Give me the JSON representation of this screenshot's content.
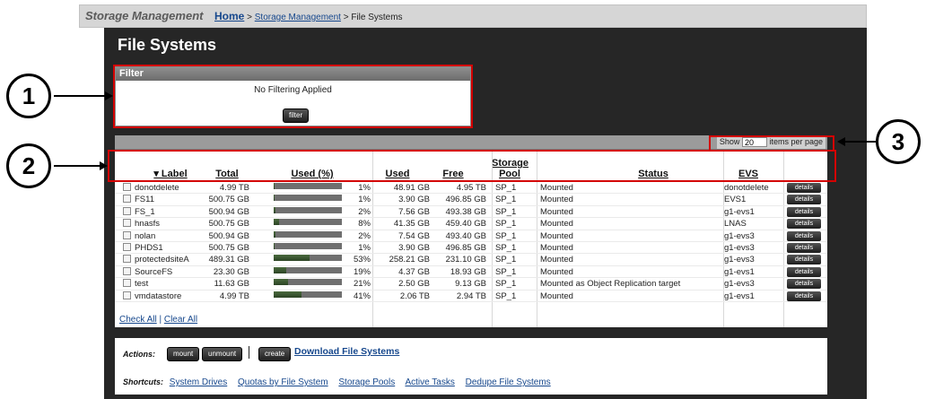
{
  "header": {
    "app_title": "Storage Management",
    "home": "Home",
    "sep1": " > ",
    "crumb_storage": "Storage Management",
    "sep2": " > ",
    "current": "File Systems"
  },
  "page_title": "File Systems",
  "filter": {
    "heading": "Filter",
    "note": "No Filtering Applied",
    "button": "filter"
  },
  "paging": {
    "show_label": "Show",
    "per_page_value": "20",
    "items_label": "items per page"
  },
  "table": {
    "headers": {
      "label": "▾ Label",
      "total": "Total",
      "used_pct": "Used (%)",
      "used": "Used",
      "free": "Free",
      "pool": "Storage Pool",
      "status": "Status",
      "evs": "EVS"
    },
    "rows": [
      {
        "label": "donotdelete",
        "total": "4.99 TB",
        "pct_text": "1%",
        "pct": 0.01,
        "used": "48.91 GB",
        "free": "4.95 TB",
        "pool": "SP_1",
        "status": "Mounted",
        "evs": "donotdelete",
        "action": "details"
      },
      {
        "label": "FS11",
        "total": "500.75 GB",
        "pct_text": "1%",
        "pct": 0.01,
        "used": "3.90 GB",
        "free": "496.85 GB",
        "pool": "SP_1",
        "status": "Mounted",
        "evs": "EVS1",
        "action": "details"
      },
      {
        "label": "FS_1",
        "total": "500.94 GB",
        "pct_text": "2%",
        "pct": 0.02,
        "used": "7.56 GB",
        "free": "493.38 GB",
        "pool": "SP_1",
        "status": "Mounted",
        "evs": "g1-evs1",
        "action": "details"
      },
      {
        "label": "hnasfs",
        "total": "500.75 GB",
        "pct_text": "8%",
        "pct": 0.08,
        "used": "41.35 GB",
        "free": "459.40 GB",
        "pool": "SP_1",
        "status": "Mounted",
        "evs": "LNAS",
        "action": "details"
      },
      {
        "label": "nolan",
        "total": "500.94 GB",
        "pct_text": "2%",
        "pct": 0.02,
        "used": "7.54 GB",
        "free": "493.40 GB",
        "pool": "SP_1",
        "status": "Mounted",
        "evs": "g1-evs3",
        "action": "details"
      },
      {
        "label": "PHDS1",
        "total": "500.75 GB",
        "pct_text": "1%",
        "pct": 0.01,
        "used": "3.90 GB",
        "free": "496.85 GB",
        "pool": "SP_1",
        "status": "Mounted",
        "evs": "g1-evs3",
        "action": "details"
      },
      {
        "label": "protectedsiteA",
        "total": "489.31 GB",
        "pct_text": "53%",
        "pct": 0.53,
        "used": "258.21 GB",
        "free": "231.10 GB",
        "pool": "SP_1",
        "status": "Mounted",
        "evs": "g1-evs3",
        "action": "details"
      },
      {
        "label": "SourceFS",
        "total": "23.30 GB",
        "pct_text": "19%",
        "pct": 0.19,
        "used": "4.37 GB",
        "free": "18.93 GB",
        "pool": "SP_1",
        "status": "Mounted",
        "evs": "g1-evs1",
        "action": "details"
      },
      {
        "label": "test",
        "total": "11.63 GB",
        "pct_text": "21%",
        "pct": 0.21,
        "used": "2.50 GB",
        "free": "9.13 GB",
        "pool": "SP_1",
        "status": "Mounted as Object Replication target",
        "evs": "g1-evs3",
        "action": "details"
      },
      {
        "label": "vmdatastore",
        "total": "4.99 TB",
        "pct_text": "41%",
        "pct": 0.41,
        "used": "2.06 TB",
        "free": "2.94 TB",
        "pool": "SP_1",
        "status": "Mounted",
        "evs": "g1-evs1",
        "action": "details"
      }
    ],
    "check_all": "Check All",
    "divider": " | ",
    "clear_all": "Clear All"
  },
  "actions": {
    "label": "Actions:",
    "mount": "mount",
    "unmount": "unmount",
    "create": "create",
    "download": "Download File Systems"
  },
  "shortcuts": {
    "label": "Shortcuts:",
    "links": [
      "System Drives",
      "Quotas by File System",
      "Storage Pools",
      "Active Tasks",
      "Dedupe File Systems"
    ]
  },
  "callouts": [
    "1",
    "2",
    "3"
  ]
}
